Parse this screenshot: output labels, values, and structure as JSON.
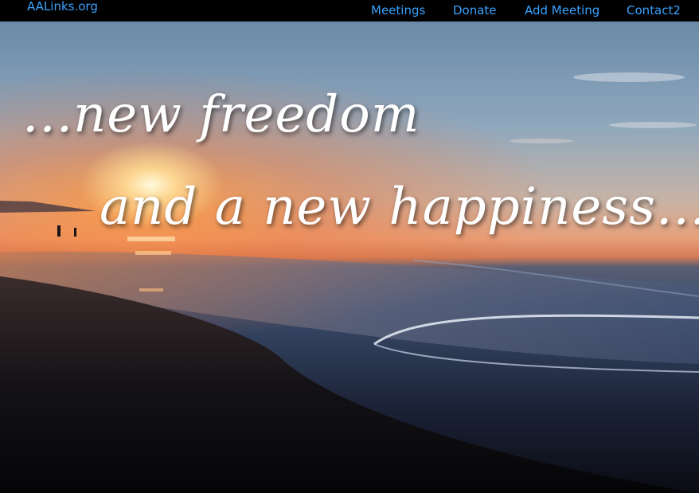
{
  "brand": {
    "label": "AALinks.org"
  },
  "nav": {
    "items": [
      {
        "label": "Meetings"
      },
      {
        "label": "Donate"
      },
      {
        "label": "Add Meeting"
      },
      {
        "label": "Contact2"
      }
    ]
  },
  "hero": {
    "line1": "...new freedom",
    "line2": "and a new happiness...."
  },
  "colors": {
    "navbar_bg": "#000000",
    "link": "#3aa2ff",
    "tagline": "#ffffff"
  }
}
